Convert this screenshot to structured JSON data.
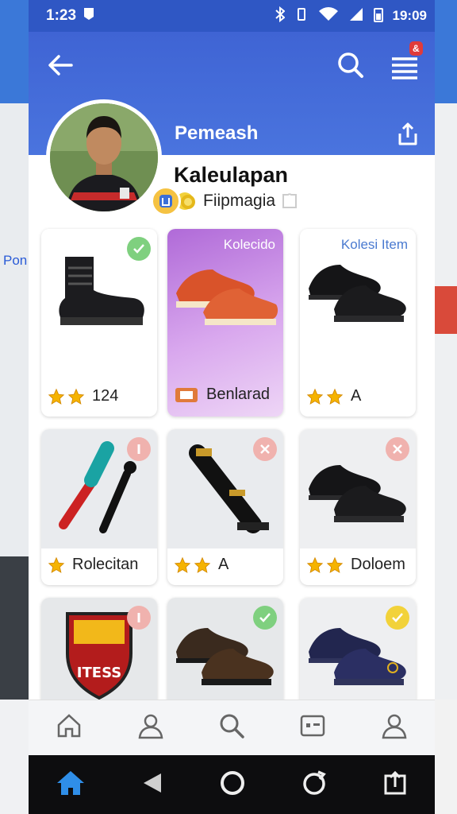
{
  "status": {
    "time_left": "1:23",
    "time_right": "19:09"
  },
  "header": {
    "title": "Pemeash",
    "badge": "&"
  },
  "profile": {
    "name": "Kaleulapan",
    "subtitle": "Fiipmagia"
  },
  "items": [
    {
      "caption": "",
      "label": "124",
      "stars": 2,
      "corner": "check",
      "corner_color": "#7fd07f",
      "img": "boot",
      "bg": "#ffffff"
    },
    {
      "caption": "Kolecido",
      "label": "Benlarad",
      "stars": 0,
      "corner": "none",
      "corner_color": "",
      "img": "orange-shoe",
      "bg": "purple"
    },
    {
      "caption": "Kolesi Item",
      "label": "A",
      "stars": 2,
      "corner": "none",
      "corner_color": "",
      "img": "black-shoe",
      "bg": "#ffffff"
    },
    {
      "caption": "",
      "label": "Rolecitan",
      "stars": 1,
      "corner": "info",
      "corner_color": "#f0b2ae",
      "img": "bat",
      "bg": "#e9ebee"
    },
    {
      "caption": "",
      "label": "A",
      "stars": 2,
      "corner": "close",
      "corner_color": "#f0b2ae",
      "img": "tool",
      "bg": "#e9ebee"
    },
    {
      "caption": "",
      "label": "Doloem",
      "stars": 2,
      "corner": "close",
      "corner_color": "#f0b2ae",
      "img": "black-shoe",
      "bg": "#eeeff1"
    },
    {
      "caption": "",
      "label": "",
      "stars": 0,
      "corner": "info",
      "corner_color": "#f0b2ae",
      "img": "shield",
      "bg": "#e6e8ea"
    },
    {
      "caption": "",
      "label": "",
      "stars": 0,
      "corner": "check",
      "corner_color": "#7fd07f",
      "img": "brown-shoe",
      "bg": "#e6e8ea"
    },
    {
      "caption": "",
      "label": "",
      "stars": 0,
      "corner": "check",
      "corner_color": "#f2d23a",
      "img": "navy-shoe",
      "bg": "#eeeff1"
    }
  ],
  "shield_text": "ITESS",
  "bottom_nav": [
    "home-icon",
    "profile-icon",
    "search-icon",
    "badge-icon",
    "account-icon"
  ],
  "colors": {
    "accent": "#3f64d4",
    "star": "#f5b301"
  }
}
